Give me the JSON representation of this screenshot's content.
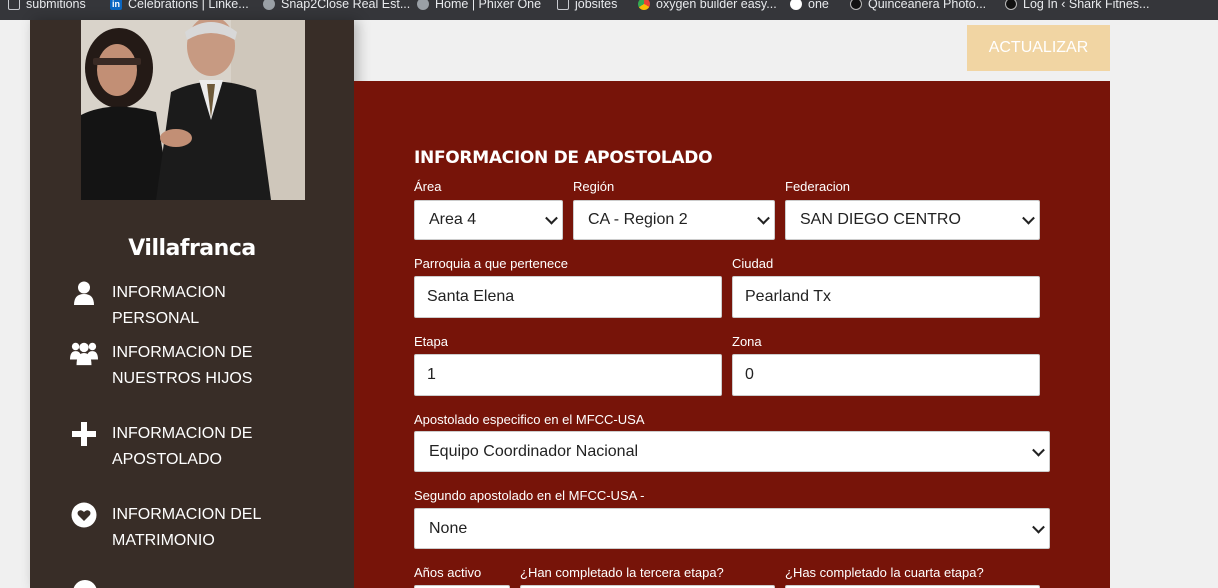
{
  "bookmarks": [
    {
      "label": "submitions",
      "icon": "page-icon"
    },
    {
      "label": "Celebrations | Linke...",
      "icon": "linkedin-icon"
    },
    {
      "label": "Snap2Close Real Est...",
      "icon": "globe-icon"
    },
    {
      "label": "Home | Phixer One",
      "icon": "globe-icon"
    },
    {
      "label": "jobsites",
      "icon": "page-icon"
    },
    {
      "label": "oxygen builder easy...",
      "icon": "chrome-icon"
    },
    {
      "label": "one",
      "icon": "info-icon"
    },
    {
      "label": "Quinceanera Photo...",
      "icon": "site-icon"
    },
    {
      "label": "Log In ‹ Shark Fitnes...",
      "icon": "site-icon"
    }
  ],
  "sidebar": {
    "name": "Villafranca",
    "items": [
      {
        "label": "INFORMACION PERSONAL",
        "icon": "user-icon"
      },
      {
        "label": "INFORMACION DE NUESTROS HIJOS",
        "icon": "users-icon"
      },
      {
        "label": "INFORMACION DE APOSTOLADO",
        "icon": "plus-icon"
      },
      {
        "label": "INFORMACION DEL MATRIMONIO",
        "icon": "heart-icon"
      }
    ]
  },
  "toolbar": {
    "update_label": "ACTUALIZAR"
  },
  "form": {
    "title": "INFORMACION DE APOSTOLADO",
    "area": {
      "label": "Área",
      "value": "Area 4"
    },
    "region": {
      "label": "Región",
      "value": "CA - Region 2"
    },
    "federacion": {
      "label": "Federacion",
      "value": "SAN DIEGO CENTRO"
    },
    "parroquia": {
      "label": "Parroquia a que pertenece",
      "value": "Santa Elena"
    },
    "ciudad": {
      "label": "Ciudad",
      "value": "Pearland Tx"
    },
    "etapa": {
      "label": "Etapa",
      "value": "1"
    },
    "zona": {
      "label": "Zona",
      "value": "0"
    },
    "apostolado": {
      "label": "Apostolado especifico en el MFCC-USA",
      "value": "Equipo Coordinador Nacional"
    },
    "segundo": {
      "label": "Segundo apostolado en el MFCC-USA -",
      "value": "None"
    },
    "anos": {
      "label": "Años activo"
    },
    "tercera": {
      "label": "¿Han completado la tercera etapa?"
    },
    "cuarta": {
      "label": "¿Has completado la cuarta etapa?"
    }
  },
  "colors": {
    "sidebar": "#382d27",
    "panel": "#771409",
    "button": "#f1d5a3"
  }
}
